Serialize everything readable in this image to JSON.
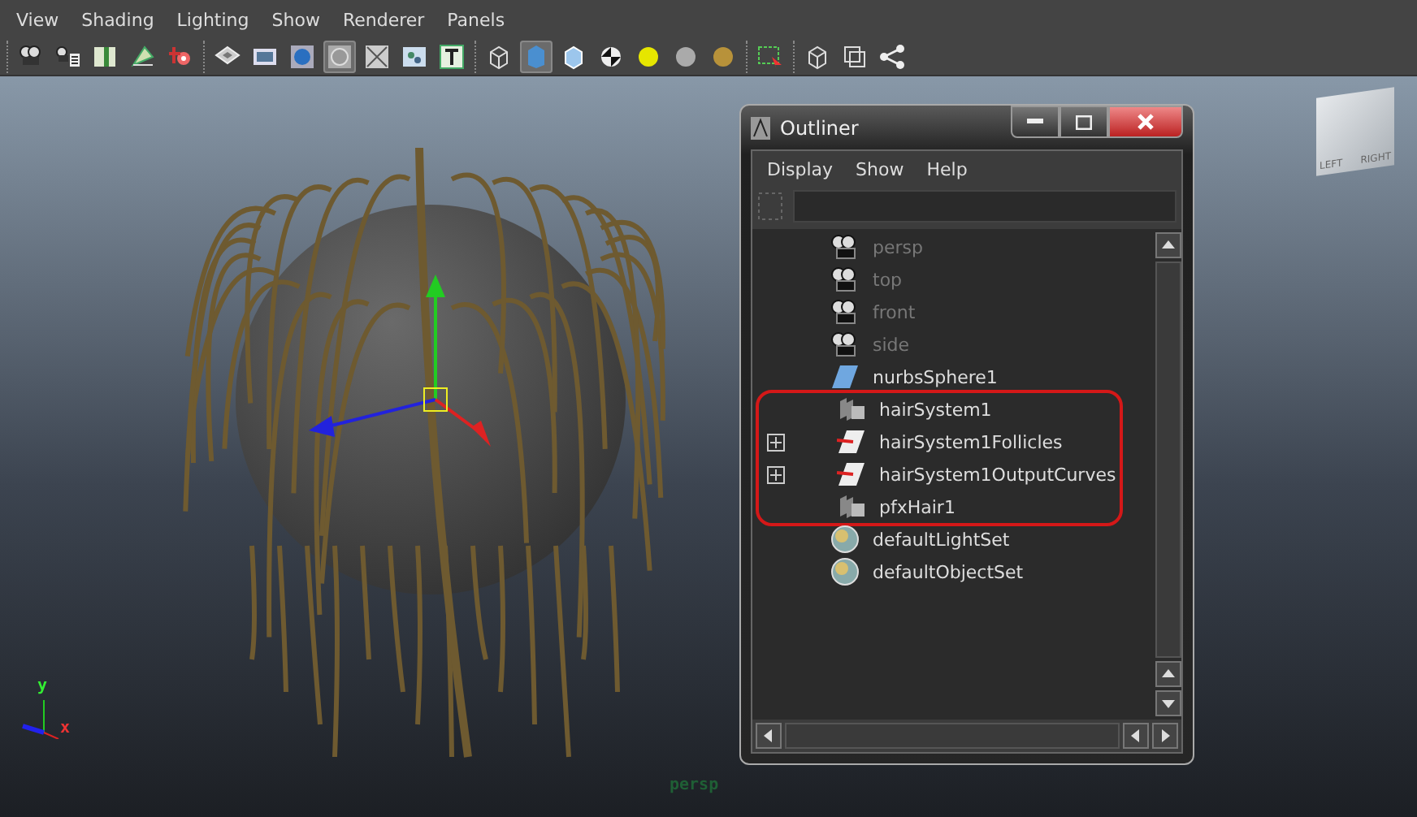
{
  "menu_bar": [
    "View",
    "Shading",
    "Lighting",
    "Show",
    "Renderer",
    "Panels"
  ],
  "toolbar": [
    {
      "items": [
        {
          "kind": "camera",
          "pressed": false
        },
        {
          "kind": "camera-list",
          "pressed": false
        },
        {
          "kind": "book",
          "pressed": false
        },
        {
          "kind": "leaf",
          "pressed": false
        },
        {
          "kind": "target",
          "pressed": false
        }
      ]
    },
    {
      "items": [
        {
          "kind": "grid",
          "pressed": false
        },
        {
          "kind": "film",
          "pressed": false
        },
        {
          "kind": "sphere-blue",
          "pressed": false
        },
        {
          "kind": "circle",
          "pressed": true
        },
        {
          "kind": "cross",
          "pressed": false
        },
        {
          "kind": "dots",
          "pressed": false
        },
        {
          "kind": "text",
          "pressed": false
        }
      ]
    },
    {
      "items": [
        {
          "kind": "cube-wire",
          "pressed": false
        },
        {
          "kind": "cube-solid",
          "pressed": true
        },
        {
          "kind": "cube-shaded",
          "pressed": false
        },
        {
          "kind": "checker",
          "pressed": false
        },
        {
          "kind": "light-yellow",
          "pressed": false
        },
        {
          "kind": "light-grey",
          "pressed": false
        },
        {
          "kind": "light-gold",
          "pressed": false
        }
      ]
    },
    {
      "items": [
        {
          "kind": "select",
          "pressed": false
        }
      ]
    },
    {
      "items": [
        {
          "kind": "cube-wire",
          "pressed": false
        },
        {
          "kind": "squares",
          "pressed": false
        },
        {
          "kind": "share",
          "pressed": false
        }
      ]
    }
  ],
  "view_cube": {
    "left": "LEFT",
    "right": "RIGHT"
  },
  "axis": {
    "y": "y",
    "x": "x"
  },
  "camera_label": "persp",
  "outliner": {
    "title": "Outliner",
    "menus": [
      "Display",
      "Show",
      "Help"
    ],
    "items": [
      {
        "label": "persp",
        "kind": "camera",
        "dimmed": true,
        "expandable": false,
        "highlighted": false
      },
      {
        "label": "top",
        "kind": "camera",
        "dimmed": true,
        "expandable": false,
        "highlighted": false
      },
      {
        "label": "front",
        "kind": "camera",
        "dimmed": true,
        "expandable": false,
        "highlighted": false
      },
      {
        "label": "side",
        "kind": "camera",
        "dimmed": true,
        "expandable": false,
        "highlighted": false
      },
      {
        "label": "nurbsSphere1",
        "kind": "surface",
        "dimmed": false,
        "expandable": false,
        "highlighted": false
      },
      {
        "label": "hairSystem1",
        "kind": "hair",
        "dimmed": false,
        "expandable": false,
        "highlighted": true
      },
      {
        "label": "hairSystem1Follicles",
        "kind": "group",
        "dimmed": false,
        "expandable": true,
        "highlighted": true
      },
      {
        "label": "hairSystem1OutputCurves",
        "kind": "group",
        "dimmed": false,
        "expandable": true,
        "highlighted": true
      },
      {
        "label": "pfxHair1",
        "kind": "hair",
        "dimmed": false,
        "expandable": false,
        "highlighted": true
      },
      {
        "label": "defaultLightSet",
        "kind": "set",
        "dimmed": false,
        "expandable": false,
        "highlighted": false
      },
      {
        "label": "defaultObjectSet",
        "kind": "set",
        "dimmed": false,
        "expandable": false,
        "highlighted": false
      }
    ]
  }
}
